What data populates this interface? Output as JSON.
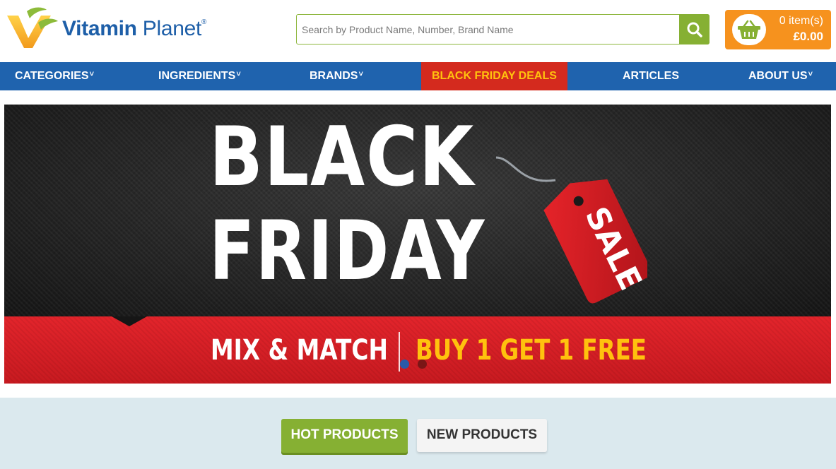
{
  "header": {
    "logo": {
      "name_bold": "Vitamin",
      "name_light": " Planet",
      "registered": "®"
    },
    "search": {
      "placeholder": "Search by Product Name, Number, Brand Name",
      "value": ""
    },
    "cart": {
      "items": "0 item(s)",
      "total": "£0.00"
    }
  },
  "nav": {
    "items": [
      {
        "label": "CATEGORIES",
        "chevron": "˅"
      },
      {
        "label": "INGREDIENTS",
        "chevron": "˅"
      },
      {
        "label": "BRANDS",
        "chevron": "˅"
      },
      {
        "label": "BLACK FRIDAY DEALS"
      },
      {
        "label": "ARTICLES"
      },
      {
        "label": "ABOUT US",
        "chevron": "˅"
      }
    ]
  },
  "banner": {
    "headline_1": "BLACK",
    "headline_2": "FRIDAY",
    "tag_text": "SALE",
    "promo_left": "MIX & MATCH",
    "promo_right": "BUY 1 GET 1 FREE",
    "slide_count": 2,
    "active_slide": 1
  },
  "product_tabs": [
    {
      "label": "HOT PRODUCTS",
      "active": true
    },
    {
      "label": "NEW PRODUCTS",
      "active": false
    }
  ],
  "colors": {
    "brand_blue": "#1f63ae",
    "brand_green": "#86b033",
    "cart_orange": "#f6921e",
    "deals_red": "#d42a1e",
    "deals_yellow": "#ffc20e",
    "section_bg": "#dbe9ee"
  },
  "icons": [
    "v-leaf-logo-icon",
    "search-icon",
    "basket-icon",
    "chevron-down-icon",
    "sale-tag-icon"
  ]
}
